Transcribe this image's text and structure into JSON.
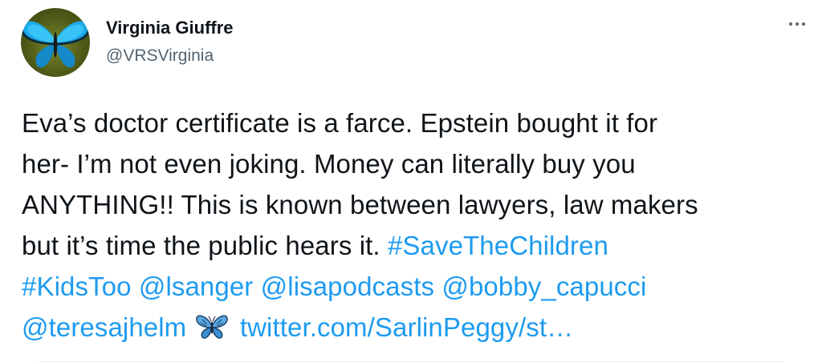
{
  "author": {
    "display_name": "Virginia Giuffre",
    "handle": "@VRSVirginia",
    "avatar_icon": "blue-butterfly-avatar"
  },
  "more_icon": "more-horizontal-icon",
  "tweet": {
    "line1": "Eva’s doctor certificate is a farce. Epstein bought it for",
    "line2": "her- I’m not even joking. Money can literally buy you",
    "line3": "ANYTHING!! This is known between lawyers, law makers",
    "line4_text": "but it’s time the public hears it.",
    "hashtag_save": "#SaveTheChildren",
    "hashtag_kids": "#KidsToo",
    "mention_1": "@lsanger",
    "mention_2": "@lisapodcasts",
    "mention_3": "@bobby_capucci",
    "mention_4": "@teresajhelm",
    "emoji_icon": "blue-butterfly-emoji",
    "link": "twitter.com/SarlinPeggy/st…"
  },
  "colors": {
    "text": "#0f1419",
    "secondary": "#536471",
    "link": "#1d9bf0",
    "butterfly": "#1e90ff"
  }
}
